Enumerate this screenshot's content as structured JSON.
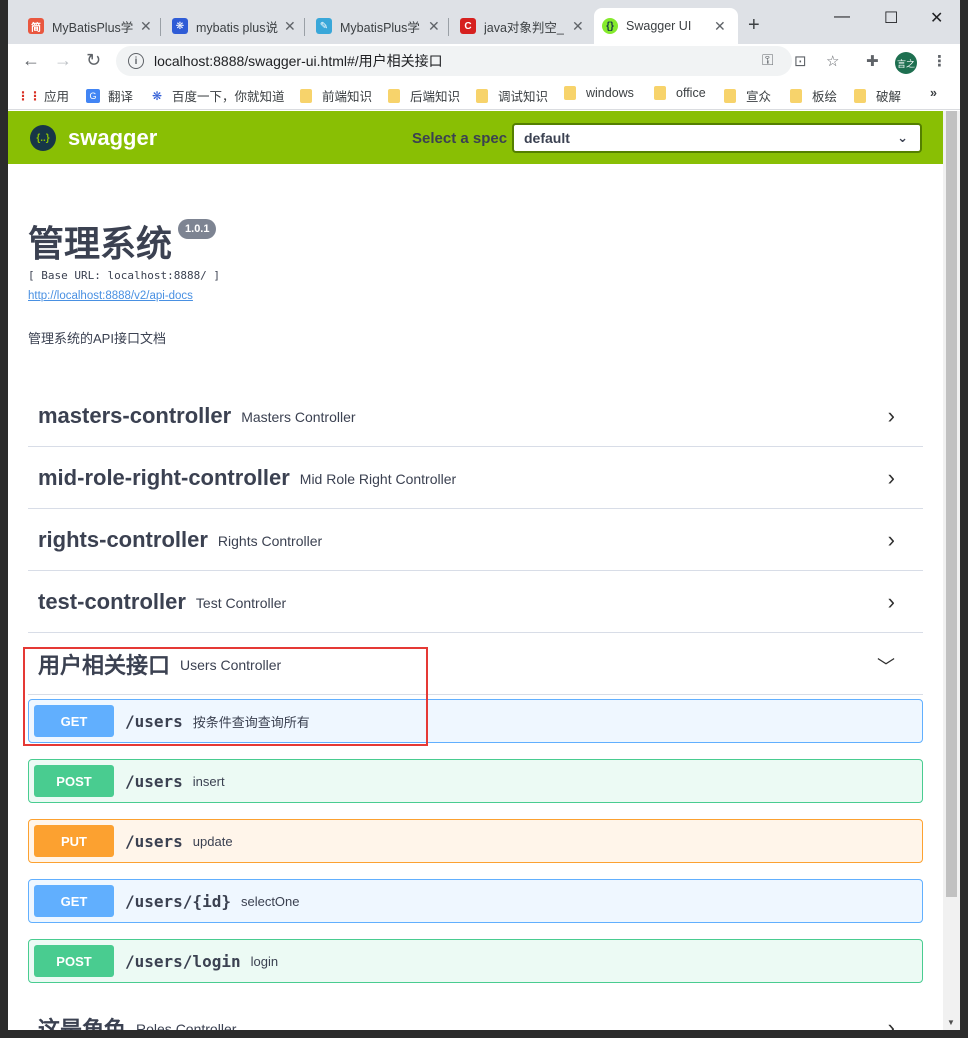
{
  "browser": {
    "tabs": [
      {
        "title": "MyBatisPlus学",
        "favicon": "jianshu-icon",
        "color": "#e9573f",
        "glyph": "简"
      },
      {
        "title": "mybatis plus说",
        "favicon": "baidu-paw-icon",
        "color": "#2f5cd6",
        "glyph": "❋"
      },
      {
        "title": "MybatisPlus学",
        "favicon": "pen-icon",
        "color": "#39a7d9",
        "glyph": "✎"
      },
      {
        "title": "java对象判空_",
        "favicon": "csdn-icon",
        "color": "#d6201f",
        "glyph": "C"
      },
      {
        "title": "Swagger UI",
        "favicon": "swagger-icon",
        "color": "#85ea2d",
        "glyph": "{}",
        "active": true
      }
    ],
    "new_tab": "+",
    "window_controls": {
      "minimize": "—",
      "maximize": "☐",
      "close": "✕"
    },
    "url": "localhost:8888/swagger-ui.html#/用户相关接口",
    "profile_initials": "言之",
    "bookmarks": [
      {
        "label": "应用",
        "type": "apps"
      },
      {
        "label": "翻译",
        "type": "translate"
      },
      {
        "label": "百度一下，你就知道",
        "type": "baidu"
      },
      {
        "label": "前端知识",
        "type": "folder"
      },
      {
        "label": "后端知识",
        "type": "folder"
      },
      {
        "label": "调试知识",
        "type": "folder"
      },
      {
        "label": "windows",
        "type": "folder"
      },
      {
        "label": "office",
        "type": "folder"
      },
      {
        "label": "宣众",
        "type": "folder"
      },
      {
        "label": "板绘",
        "type": "folder"
      },
      {
        "label": "破解",
        "type": "folder"
      }
    ],
    "more_bookmarks": "»"
  },
  "swagger": {
    "logo_text": "swagger",
    "spec_label": "Select a spec",
    "spec_value": "default",
    "title": "管理系统",
    "version": "1.0.1",
    "base_url": "[ Base URL: localhost:8888/ ]",
    "api_docs_link": "http://localhost:8888/v2/api-docs",
    "description": "管理系统的API接口文档",
    "tags": [
      {
        "name": "masters-controller",
        "desc": "Masters Controller",
        "expanded": false
      },
      {
        "name": "mid-role-right-controller",
        "desc": "Mid Role Right Controller",
        "expanded": false
      },
      {
        "name": "rights-controller",
        "desc": "Rights Controller",
        "expanded": false
      },
      {
        "name": "test-controller",
        "desc": "Test Controller",
        "expanded": false
      },
      {
        "name": "用户相关接口",
        "desc": "Users Controller",
        "expanded": true
      },
      {
        "name": "这是角色",
        "desc": "Roles Controller",
        "expanded": false
      }
    ],
    "operations": [
      {
        "method": "GET",
        "path": "/users",
        "summary": "按条件查询查询所有"
      },
      {
        "method": "POST",
        "path": "/users",
        "summary": "insert"
      },
      {
        "method": "PUT",
        "path": "/users",
        "summary": "update"
      },
      {
        "method": "GET",
        "path": "/users/{id}",
        "summary": "selectOne"
      },
      {
        "method": "POST",
        "path": "/users/login",
        "summary": "login"
      }
    ]
  },
  "colors": {
    "swagger_green": "#89bf04",
    "get": "#61affe",
    "post": "#49cc90",
    "put": "#fca130",
    "annotation_red": "#e53935"
  }
}
